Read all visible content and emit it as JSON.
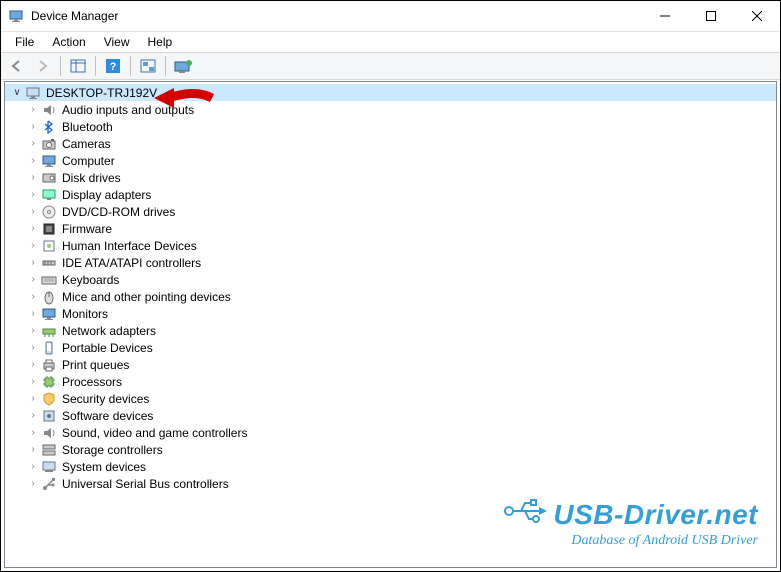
{
  "window": {
    "title": "Device Manager"
  },
  "menu": {
    "file": "File",
    "action": "Action",
    "view": "View",
    "help": "Help"
  },
  "tree": {
    "root": "DESKTOP-TRJ192V",
    "items": [
      "Audio inputs and outputs",
      "Bluetooth",
      "Cameras",
      "Computer",
      "Disk drives",
      "Display adapters",
      "DVD/CD-ROM drives",
      "Firmware",
      "Human Interface Devices",
      "IDE ATA/ATAPI controllers",
      "Keyboards",
      "Mice and other pointing devices",
      "Monitors",
      "Network adapters",
      "Portable Devices",
      "Print queues",
      "Processors",
      "Security devices",
      "Software devices",
      "Sound, video and game controllers",
      "Storage controllers",
      "System devices",
      "Universal Serial Bus controllers"
    ]
  },
  "watermark": {
    "main": "USB-Driver.net",
    "sub": "Database of Android USB Driver"
  },
  "icons": {
    "root": "computer-icon",
    "items": [
      "speaker-icon",
      "bluetooth-icon",
      "camera-icon",
      "monitor-icon",
      "disk-icon",
      "display-icon",
      "dvd-icon",
      "firmware-icon",
      "hid-icon",
      "ide-icon",
      "keyboard-icon",
      "mouse-icon",
      "monitor-icon",
      "network-icon",
      "portable-icon",
      "printer-icon",
      "cpu-icon",
      "security-icon",
      "software-icon",
      "sound-icon",
      "storage-icon",
      "system-icon",
      "usb-icon"
    ]
  }
}
